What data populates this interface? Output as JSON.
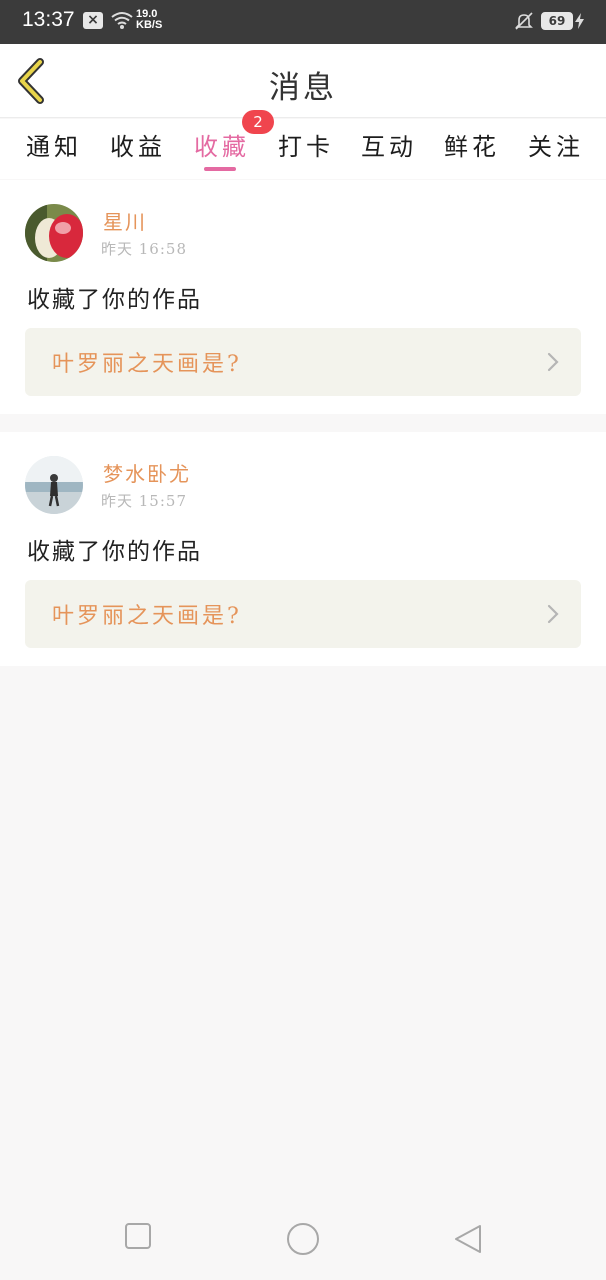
{
  "status_bar": {
    "time": "13:37",
    "notification_icon": "x-box-icon",
    "speed_value": "19.0",
    "speed_unit": "KB/S",
    "battery": "69"
  },
  "header": {
    "title": "消息",
    "back_icon": "chevron-left-icon"
  },
  "tabs": [
    {
      "label": "通知",
      "active": false
    },
    {
      "label": "收益",
      "active": false
    },
    {
      "label": "收藏",
      "active": true,
      "badge": "2"
    },
    {
      "label": "打卡",
      "active": false
    },
    {
      "label": "互动",
      "active": false
    },
    {
      "label": "鲜花",
      "active": false
    },
    {
      "label": "关注",
      "active": false
    }
  ],
  "messages": [
    {
      "username": "星川",
      "time": "昨天 16:58",
      "action": "收藏了你的作品",
      "work_title": "叶罗丽之天画是?"
    },
    {
      "username": "梦水卧尤",
      "time": "昨天 15:57",
      "action": "收藏了你的作品",
      "work_title": "叶罗丽之天画是?"
    }
  ],
  "nav_bar": [
    "square-icon",
    "circle-icon",
    "triangle-back-icon"
  ],
  "colors": {
    "accent_pink": "#e46aa2",
    "accent_orange": "#e5945a",
    "badge_red": "#f0454e",
    "back_yellow": "#e8d44a"
  }
}
